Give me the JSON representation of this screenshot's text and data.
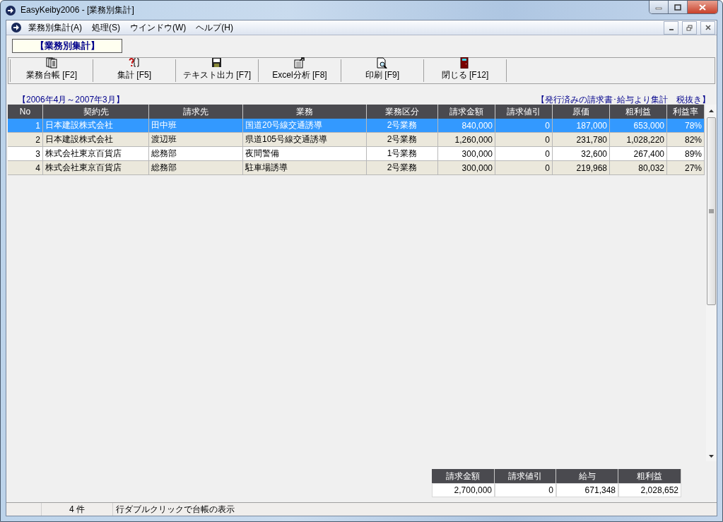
{
  "window": {
    "title": "EasyKeiby2006 - [業務別集計]"
  },
  "menu": [
    {
      "label": "業務別集計(A)"
    },
    {
      "label": "処理(S)"
    },
    {
      "label": "ウインドウ(W)"
    },
    {
      "label": "ヘルプ(H)"
    }
  ],
  "header_label": "【業務別集計】",
  "toolbar": [
    {
      "label": "業務台帳 [F2]",
      "kind": "ledger"
    },
    {
      "label": "集計 [F5]",
      "kind": "aggregate"
    },
    {
      "label": "テキスト出力 [F7]",
      "kind": "save"
    },
    {
      "label": "Excel分析 [F8]",
      "kind": "export"
    },
    {
      "label": "印刷 [F9]",
      "kind": "preview"
    },
    {
      "label": "閉じる [F12]",
      "kind": "exit"
    }
  ],
  "period": "【2006年4月～2007年3月】",
  "note": "【発行済みの請求書･給与より集計　税抜き】",
  "table": {
    "columns": [
      "No",
      "契約先",
      "請求先",
      "業務",
      "業務区分",
      "請求金額",
      "請求値引",
      "原価",
      "粗利益",
      "利益率"
    ],
    "rows": [
      {
        "selected": true,
        "cells": [
          "1",
          "日本建設株式会社",
          "田中班",
          "国道20号線交通誘導",
          "2号業務",
          "840,000",
          "0",
          "187,000",
          "653,000",
          "78%"
        ]
      },
      {
        "selected": false,
        "cells": [
          "2",
          "日本建設株式会社",
          "渡辺班",
          "県道105号線交通誘導",
          "2号業務",
          "1,260,000",
          "0",
          "231,780",
          "1,028,220",
          "82%"
        ]
      },
      {
        "selected": false,
        "cells": [
          "3",
          "株式会社東京百貨店",
          "総務部",
          "夜間警備",
          "1号業務",
          "300,000",
          "0",
          "32,600",
          "267,400",
          "89%"
        ]
      },
      {
        "selected": false,
        "cells": [
          "4",
          "株式会社東京百貨店",
          "総務部",
          "駐車場誘導",
          "2号業務",
          "300,000",
          "0",
          "219,968",
          "80,032",
          "27%"
        ]
      }
    ]
  },
  "summary": {
    "columns": [
      "請求金額",
      "請求値引",
      "給与",
      "粗利益"
    ],
    "values": [
      "2,700,000",
      "0",
      "671,348",
      "2,028,652"
    ]
  },
  "status_bar": {
    "count": "4 件",
    "message": "行ダブルクリックで台帳の表示"
  }
}
